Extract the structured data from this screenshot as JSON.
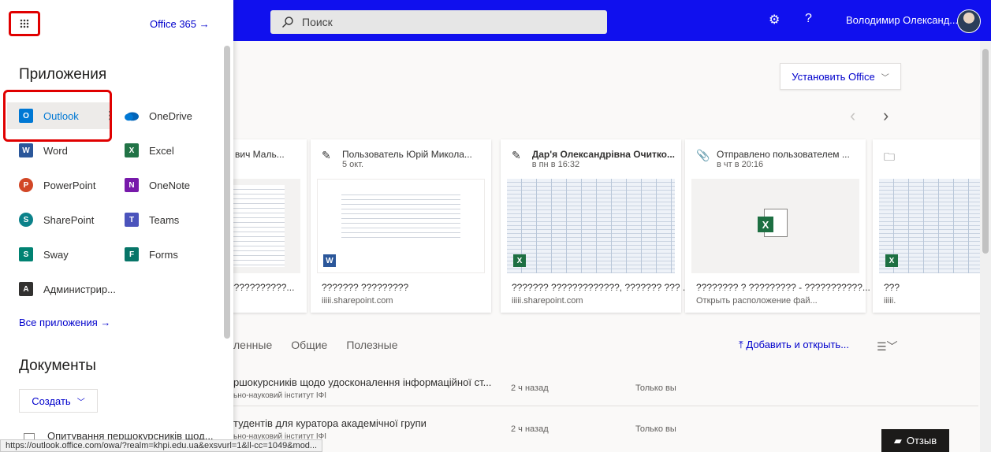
{
  "topbar": {
    "search_placeholder": "Поиск",
    "user_name": "Володимир Олександ...",
    "help": "?"
  },
  "main": {
    "install_office": "Установить Office",
    "cards": [
      {
        "who": "вич Маль...",
        "when": "",
        "name": "???????????...",
        "site": ""
      },
      {
        "who": "Пользователь Юрій Микола...",
        "when": "5 окт.",
        "name": "??????? ?????????",
        "site": "iiiii.sharepoint.com"
      },
      {
        "who": "Дар'я Олександрівна Очитко...",
        "when": "в пн в 16:32",
        "name": "??????? ?????????????, ??????? ??? ...",
        "site": "iiiii.sharepoint.com"
      },
      {
        "who": "Отправлено пользователем ...",
        "when": "в чт в 20:16",
        "name": "???????? ? ????????? - ???????????...",
        "site": "Открыть расположение фай..."
      },
      {
        "who": "",
        "when": "",
        "name": "???",
        "site": "iiiii."
      }
    ],
    "tabs": [
      "ленные",
      "Общие",
      "Полезные"
    ],
    "add_open": "Добавить и открыть...",
    "rows": [
      {
        "title": "ршокурсників щодо удосконалення інформаційної ст...",
        "sub": "ьно-науковий інститут ІФІ",
        "date": "2 ч назад",
        "owner": "Только вы"
      },
      {
        "title": "тудентів для куратора академічної групи",
        "sub": "ьно-науковий інститут ІФІ",
        "date": "2 ч назад",
        "owner": "Только вы"
      }
    ],
    "feedback": "Отзыв"
  },
  "panel": {
    "office365": "Office 365",
    "apps_title": "Приложения",
    "apps": [
      {
        "label": "Outlook",
        "color": "#0078d4",
        "letter": "O"
      },
      {
        "label": "OneDrive",
        "color": "#0364b8",
        "letter": ""
      },
      {
        "label": "Word",
        "color": "#2b579a",
        "letter": "W"
      },
      {
        "label": "Excel",
        "color": "#217346",
        "letter": "X"
      },
      {
        "label": "PowerPoint",
        "color": "#d24726",
        "letter": "P"
      },
      {
        "label": "OneNote",
        "color": "#7719aa",
        "letter": "N"
      },
      {
        "label": "SharePoint",
        "color": "#0b828a",
        "letter": "S"
      },
      {
        "label": "Teams",
        "color": "#4b53bc",
        "letter": "T"
      },
      {
        "label": "Sway",
        "color": "#008272",
        "letter": "S"
      },
      {
        "label": "Forms",
        "color": "#077568",
        "letter": "F"
      },
      {
        "label": "Администрир...",
        "color": "#323130",
        "letter": "A"
      }
    ],
    "all_apps": "Все приложения",
    "docs_title": "Документы",
    "create": "Создать",
    "doc_item": "Опитування першокурсників щод..."
  },
  "status_url": "https://outlook.office.com/owa/?realm=khpi.edu.ua&exsvurl=1&ll-cc=1049&mod..."
}
